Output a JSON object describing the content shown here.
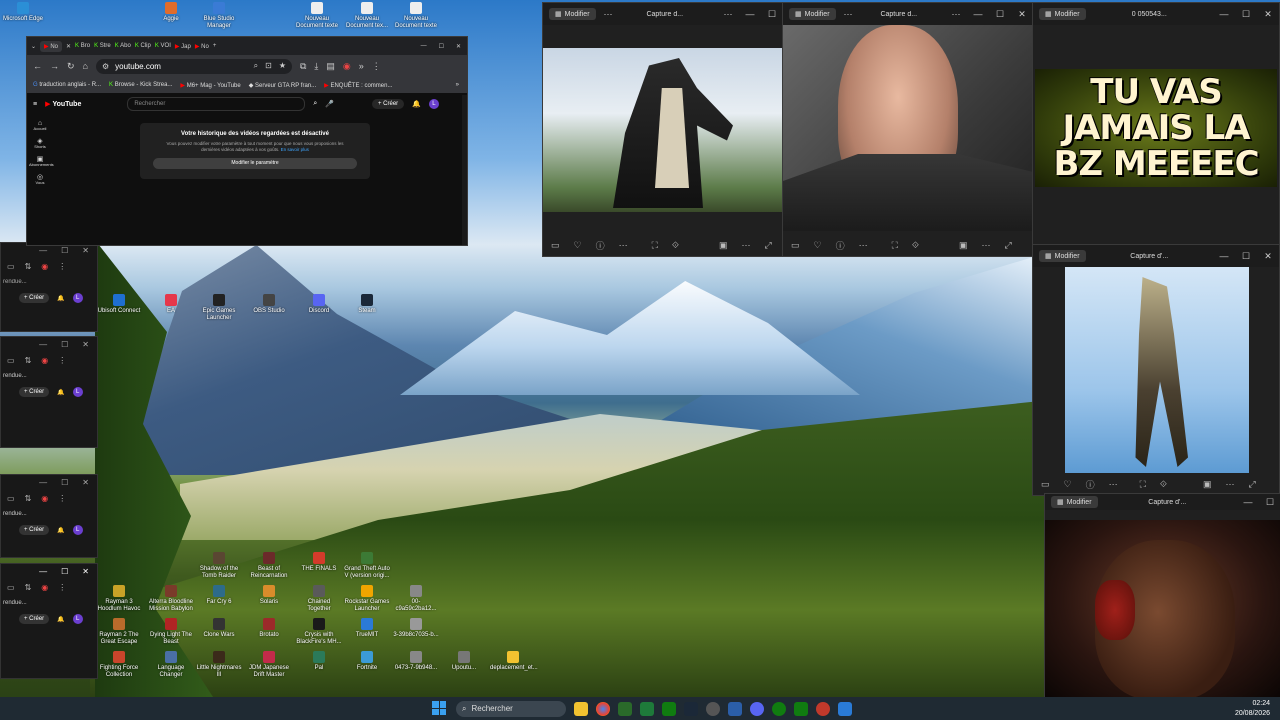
{
  "desktop_icons_top": [
    {
      "label": "Microsoft Edge"
    },
    {
      "label": "Aggie"
    },
    {
      "label": "Blue Studio Manager"
    },
    {
      "label": "Nouveau Document texte"
    },
    {
      "label": "Nouveau Document tex..."
    },
    {
      "label": "Nouveau Document texte"
    }
  ],
  "desktop_icons_mid": [
    {
      "label": "Ubisoft Connect"
    },
    {
      "label": "EA"
    },
    {
      "label": "Epic Games Launcher"
    },
    {
      "label": "OBS Studio"
    },
    {
      "label": "Discord"
    },
    {
      "label": "Steam"
    }
  ],
  "desktop_icons_bottom": [
    {
      "label": "Shadow of the Tomb Raider"
    },
    {
      "label": "Beast of Reincarnation"
    },
    {
      "label": "THE FINALS"
    },
    {
      "label": "Grand Theft Auto V (version origi..."
    },
    {
      "label": "Rayman 3 Hoodlum Havoc"
    },
    {
      "label": "Alterra Bloodline Mission Babylon"
    },
    {
      "label": "Far Cry 6"
    },
    {
      "label": "Solaris"
    },
    {
      "label": "Chained Together"
    },
    {
      "label": "Rockstar Games Launcher"
    },
    {
      "label": "00-c9a59c2ba12..."
    },
    {
      "label": "Rayman 2 The Great Escape"
    },
    {
      "label": "Dying Light The Beast"
    },
    {
      "label": "Clone Wars"
    },
    {
      "label": "Brotato"
    },
    {
      "label": "Crysis with BlackFire's MH..."
    },
    {
      "label": "TrueMIT"
    },
    {
      "label": "3-39b8c7035-b..."
    },
    {
      "label": "Fighting Force Collection"
    },
    {
      "label": "Language Changer"
    },
    {
      "label": "Little Nightmares III"
    },
    {
      "label": "JDM Japanese Drift Master"
    },
    {
      "label": "Pal"
    },
    {
      "label": "Fortnite"
    },
    {
      "label": "0473-7-9b948..."
    },
    {
      "label": "Upoutu..."
    },
    {
      "label": "deplacement_et..."
    }
  ],
  "browser": {
    "tabs": [
      "No",
      "Bro",
      "Stre",
      "Abo",
      "Clip",
      "VOI",
      "Jap",
      "No"
    ],
    "url": "youtube.com",
    "bookmarks": [
      "traduction anglais - R...",
      "Browse - Kick Strea...",
      "M6+ Mag - YouTube",
      "Serveur GTA RP fran...",
      "ENQUÊTE : commen..."
    ],
    "search_placeholder": "Rechercher",
    "logo": "YouTube",
    "create_label": "Créer",
    "avatar_letter": "L",
    "sidebar": [
      "Accueil",
      "Shorts",
      "Abonnements",
      "Vous"
    ],
    "history_title": "Votre historique des vidéos regardées est désactivé",
    "history_body": "Vous pouvez modifier votre paramètre à tout moment pour que nous vous proposions les dernières vidéos adaptées à vos goûts.",
    "history_link": "En savoir plus",
    "history_button": "Modifier le paramètre"
  },
  "photo_windows": [
    {
      "edit_label": "Modifier",
      "title": "Capture d..."
    },
    {
      "edit_label": "Modifier",
      "title": "Capture d..."
    },
    {
      "edit_label": "Modifier",
      "title": "0 050543..."
    },
    {
      "edit_label": "Modifier",
      "title": "Capture d'..."
    },
    {
      "edit_label": "Modifier",
      "title": "Capture d'..."
    }
  ],
  "thumbnail_text": "TU VAS JAMAIS LA BZ MEEEEC",
  "side_windows": [
    {
      "text": "rendue...",
      "create_label": "Créer",
      "avatar": "L"
    },
    {
      "text": "rendue...",
      "create_label": "Créer",
      "avatar": "L"
    },
    {
      "text": "rendue...",
      "create_label": "Créer",
      "avatar": "L"
    },
    {
      "text": "rendue...",
      "create_label": "Créer",
      "avatar": "L"
    }
  ],
  "taskbar": {
    "search_label": "Rechercher",
    "time": "02:24",
    "date": "20/08/2026"
  }
}
